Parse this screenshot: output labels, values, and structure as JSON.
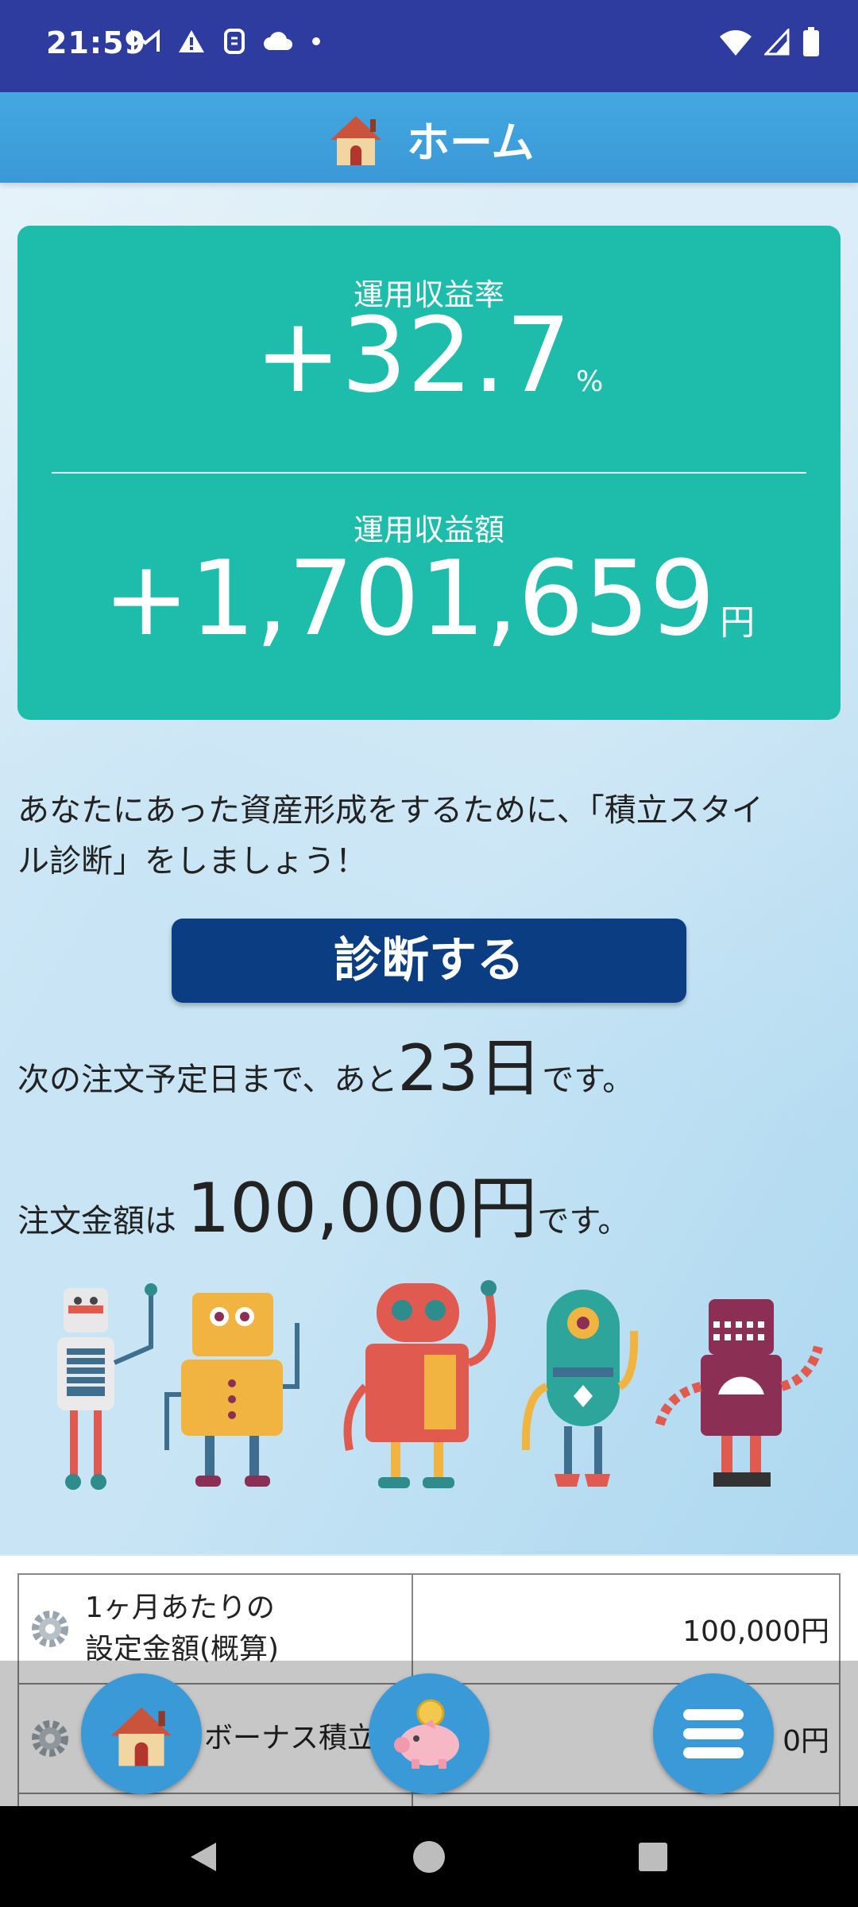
{
  "status_bar": {
    "time": "21:59",
    "notification_icons": [
      "gmail-icon",
      "warning-icon",
      "app-icon",
      "cloud-icon",
      "dot-icon"
    ],
    "system_icons": [
      "wifi-icon",
      "signal-icon",
      "battery-icon"
    ]
  },
  "app_bar": {
    "title": "ホーム",
    "icon": "house-icon"
  },
  "summary": {
    "rate_label": "運用収益率",
    "rate_value": "+32.7",
    "rate_unit": "%",
    "amount_label": "運用収益額",
    "amount_value": "+1,701,659",
    "amount_unit": "円"
  },
  "intro": {
    "line1": "あなたにあった資産形成をするために、「積立スタイ",
    "line2": "ル診断」をしましょう！"
  },
  "diagnosis_button": {
    "label": "診断する"
  },
  "next_order": {
    "prefix": "次の注文予定日まで、あと",
    "days": "23日",
    "suffix": "です。"
  },
  "order_amount": {
    "prefix": "注文金額は",
    "amount": "100,000円",
    "suffix": "です。"
  },
  "settings_table": {
    "rows": [
      {
        "label_line1": "1ヶ月あたりの",
        "label_line2": "設定金額(概算)",
        "value": "100,000円"
      },
      {
        "label_line1": "ボーナス積立",
        "label_line2": "",
        "value": "0円"
      }
    ]
  },
  "bottom_buttons": [
    {
      "name": "home",
      "icon": "house-icon"
    },
    {
      "name": "savings",
      "icon": "piggy-bank-icon"
    },
    {
      "name": "menu",
      "icon": "menu-icon"
    }
  ],
  "nav_bar": {
    "icons": [
      "back-icon",
      "home-nav-icon",
      "recents-icon"
    ]
  },
  "colors": {
    "status_bar": "#2f3c9f",
    "app_bar": "#3a9ad8",
    "card": "#1dbcab",
    "button": "#0b3d82"
  }
}
